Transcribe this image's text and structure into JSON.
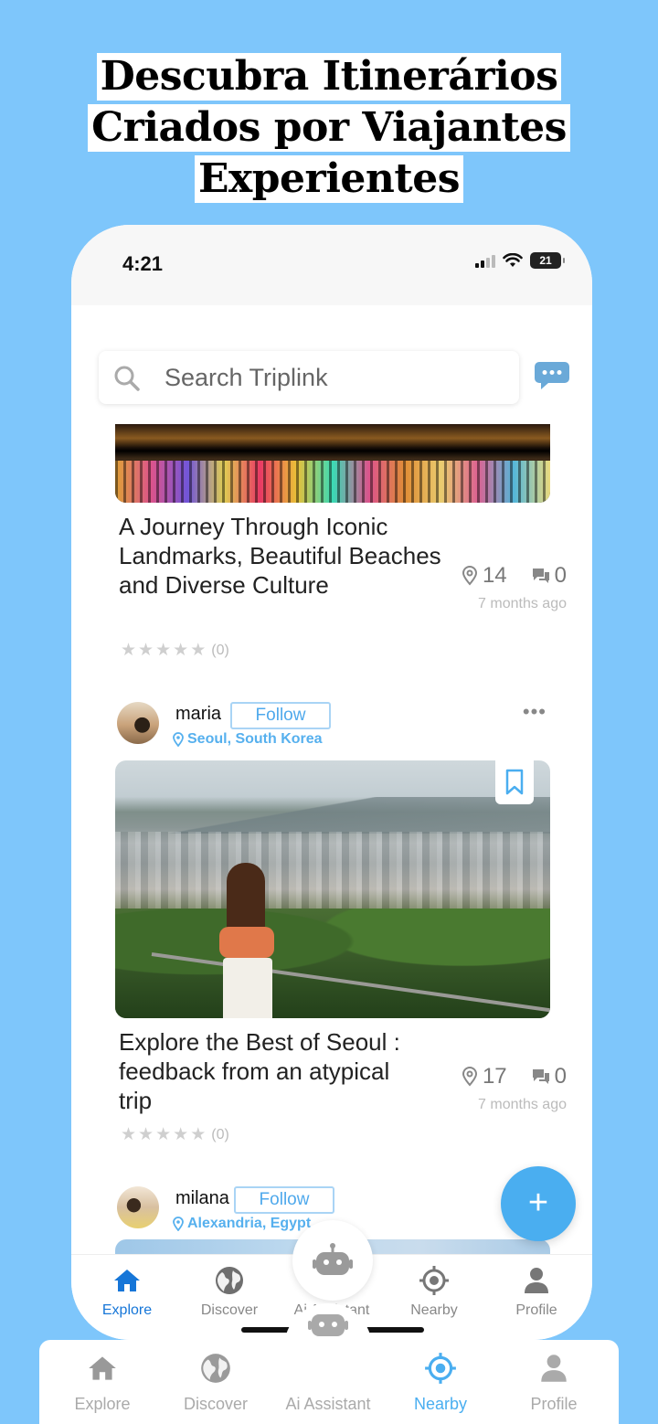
{
  "headline": {
    "line1": "Descubra Itinerários",
    "line2": "Criados por Viajantes",
    "line3": "Experientes"
  },
  "status_bar": {
    "time": "4:21",
    "battery": "21"
  },
  "search": {
    "placeholder": "Search Triplink"
  },
  "posts": [
    {
      "title": "A Journey Through Iconic Landmarks, Beautiful Beaches and Diverse Culture",
      "places": "14",
      "comments": "0",
      "ago": "7 months ago",
      "rating_count": "(0)"
    },
    {
      "user": "maria",
      "follow_label": "Follow",
      "location": "Seoul, South Korea",
      "title": "Explore the Best of Seoul : feedback from an atypical trip",
      "places": "17",
      "comments": "0",
      "ago": "7 months ago",
      "rating_count": "(0)"
    },
    {
      "user": "milana",
      "follow_label": "Follow",
      "location": "Alexandria, Egypt"
    }
  ],
  "fab_label": "+",
  "tabs": [
    "Explore",
    "Discover",
    "Ai Assistant",
    "Nearby",
    "Profile"
  ],
  "active_tab": "Explore",
  "outer_tabs": [
    "Explore",
    "Discover",
    "Ai Assistant",
    "Nearby",
    "Profile"
  ],
  "outer_active_tab": "Nearby",
  "colors": {
    "background": "#7ec6fb",
    "accent": "#4aaef0",
    "active_tab": "#1676d8"
  }
}
